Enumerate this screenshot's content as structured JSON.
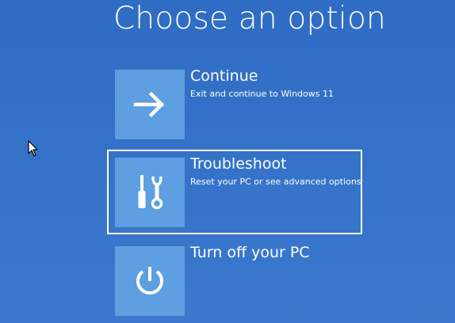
{
  "page": {
    "title": "Choose an option"
  },
  "options": [
    {
      "title": "Continue",
      "description": "Exit and continue to Windows 11",
      "icon": "arrow-right-icon",
      "focused": false
    },
    {
      "title": "Troubleshoot",
      "description": "Reset your PC or see advanced options",
      "icon": "tools-icon",
      "focused": true
    },
    {
      "title": "Turn off your PC",
      "description": "",
      "icon": "power-icon",
      "focused": false
    }
  ],
  "colors": {
    "background": "#2f6cc4",
    "tile": "#5d9fe0",
    "text": "#ffffff",
    "focus_border": "#ffffff"
  }
}
